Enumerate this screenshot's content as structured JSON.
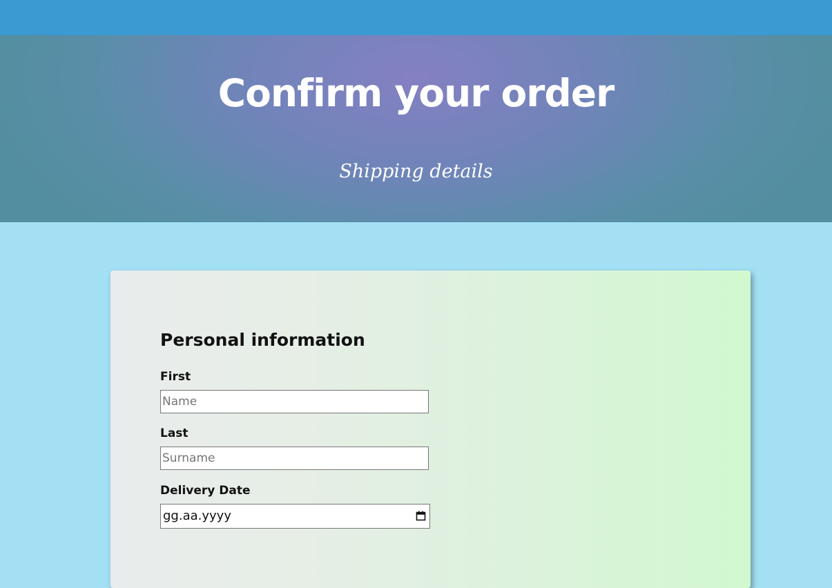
{
  "header": {
    "title": "Confirm your order",
    "subtitle": "Shipping details"
  },
  "form": {
    "section_title": "Personal information",
    "first": {
      "label": "First",
      "placeholder": "Name"
    },
    "last": {
      "label": "Last",
      "placeholder": "Surname"
    },
    "delivery_date": {
      "label": "Delivery Date",
      "display_value": "gg.aa.yyyy",
      "icon": "calendar-icon"
    }
  },
  "colors": {
    "top_bar": "#3a9ad1",
    "hero_center": "#8580c2",
    "hero_edge": "#538ea0",
    "page_background": "#a3e0f4",
    "card_left": "#e9ecec",
    "card_right": "#d1f8cf"
  }
}
